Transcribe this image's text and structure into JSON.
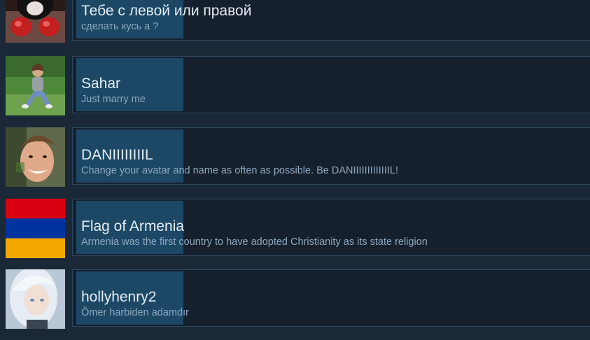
{
  "items": [
    {
      "title": "Тебе с левой или правой",
      "description": "сделать кусь а ?",
      "avatar_icon": "boxing-gloves-avatar"
    },
    {
      "title": "Sahar",
      "description": "Just marry me",
      "avatar_icon": "person-sitting-grass-avatar"
    },
    {
      "title": "DANIIIIIIIIL",
      "description": "Change your avatar and name as often as possible. Be DANIIIIIIIIIIIIIL!",
      "avatar_icon": "smiling-man-avatar"
    },
    {
      "title": "Flag of Armenia",
      "description": "Armenia was the first country to have adopted Christianity as its state religion",
      "avatar_icon": "armenia-flag-avatar",
      "flag_colors": [
        "#d90012",
        "#0033a0",
        "#f2a800"
      ]
    },
    {
      "title": "hollyhenry2",
      "description": "Ömer harbiden adamdır",
      "avatar_icon": "anime-girl-avatar"
    }
  ]
}
